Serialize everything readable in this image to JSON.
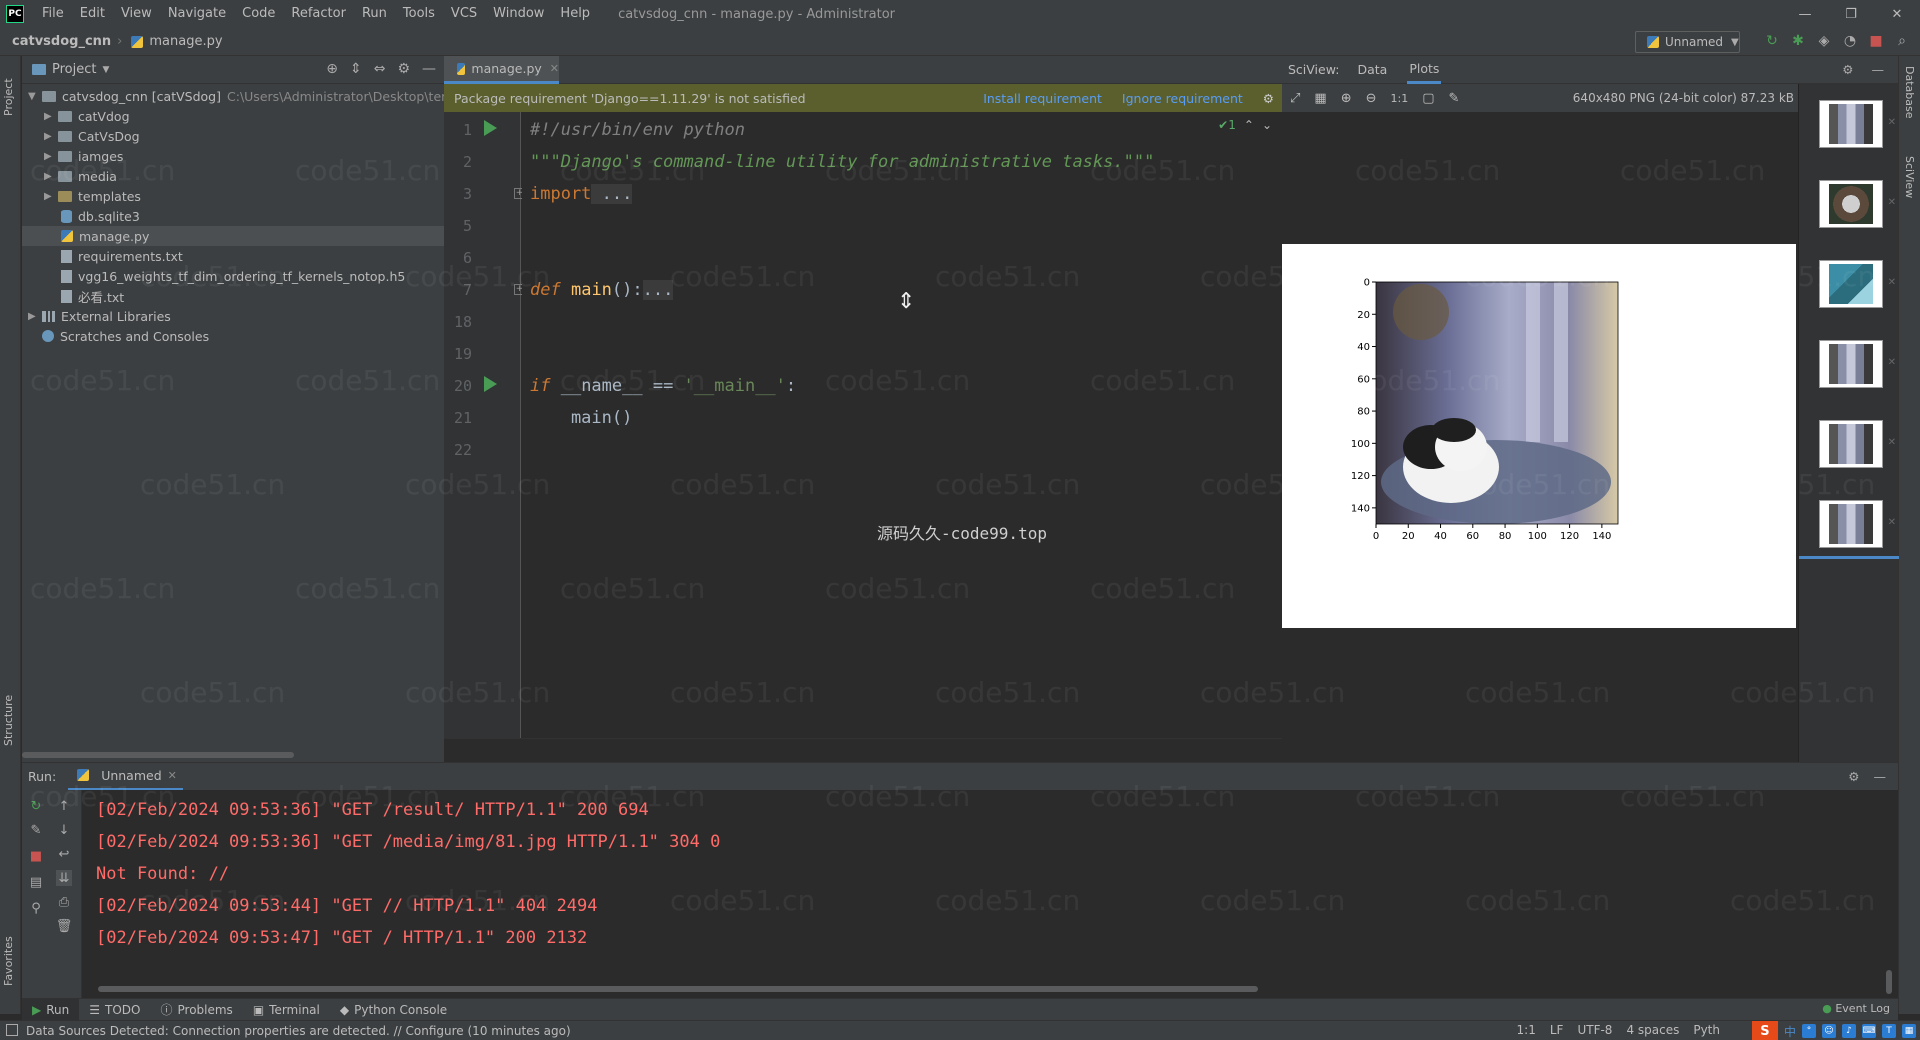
{
  "window": {
    "title": "catvsdog_cnn - manage.py - Administrator",
    "app_logo": "PC",
    "controls": [
      "—",
      "❐",
      "✕"
    ]
  },
  "menu": [
    "File",
    "Edit",
    "View",
    "Navigate",
    "Code",
    "Refactor",
    "Run",
    "Tools",
    "VCS",
    "Window",
    "Help"
  ],
  "navbar": {
    "project": "catvsdog_cnn",
    "file": "manage.py",
    "run_config": "Unnamed"
  },
  "left_strip": {
    "project_tab": "Project",
    "structure_tab": "Structure",
    "favorites_tab": "Favorites"
  },
  "right_strip": {
    "database_tab": "Database",
    "sciview_tab": "SciView"
  },
  "project_pane": {
    "header": "Project",
    "root": {
      "name": "catvsdog_cnn [catVSdog]",
      "path": "C:\\Users\\Administrator\\Desktop\\temp"
    },
    "items": [
      {
        "label": "catVdog",
        "kind": "folder"
      },
      {
        "label": "CatVsDog",
        "kind": "folder"
      },
      {
        "label": "iamges",
        "kind": "folder"
      },
      {
        "label": "media",
        "kind": "folder"
      },
      {
        "label": "templates",
        "kind": "folder"
      },
      {
        "label": "db.sqlite3",
        "kind": "db"
      },
      {
        "label": "manage.py",
        "kind": "py"
      },
      {
        "label": "requirements.txt",
        "kind": "file"
      },
      {
        "label": "vgg16_weights_tf_dim_ordering_tf_kernels_notop.h5",
        "kind": "file"
      },
      {
        "label": "必看.txt",
        "kind": "file"
      }
    ],
    "external_libraries": "External Libraries",
    "scratches": "Scratches and Consoles"
  },
  "editor": {
    "tab": "manage.py",
    "banner": {
      "message": "Package requirement 'Django==1.11.29' is not satisfied",
      "install": "Install requirement",
      "ignore": "Ignore requirement"
    },
    "inspection_count": "✔1",
    "line_numbers": [
      "1",
      "2",
      "3",
      "5",
      "6",
      "7",
      "18",
      "19",
      "20",
      "21",
      "22"
    ],
    "code": {
      "l1": "#!/usr/bin/env python",
      "l2": "\"\"\"Django's command-line utility for administrative tasks.\"\"\"",
      "l3_kw": "import",
      "l3_fold": " ...",
      "l7_def": "def",
      "l7_name": "main",
      "l7_paren": "():",
      "l7_fold": "...",
      "l20_if": "if",
      "l20_rest": " __name__ == ",
      "l20_str": "'__main__'",
      "l20_colon": ":",
      "l21": "    main()"
    },
    "overlay_text": "源码久久-code99.top"
  },
  "sciview": {
    "label": "SciView:",
    "tabs": [
      "Data",
      "Plots"
    ],
    "active_tab": "Plots",
    "image_info": "640x480 PNG (24-bit color) 87.23 kB",
    "toolbar_icons": [
      "fit-icon",
      "grid-icon",
      "zoom-in-icon",
      "zoom-out-icon",
      "actual-size-icon",
      "background-icon",
      "eyedropper-icon"
    ],
    "toolbar_actual_size": "1:1",
    "thumbnails": [
      "cat",
      "dog",
      "teal",
      "cat",
      "cat",
      "cat"
    ]
  },
  "chart_data": {
    "type": "image",
    "title": "",
    "xlabel": "",
    "ylabel": "",
    "x_ticks": [
      "0",
      "20",
      "40",
      "60",
      "80",
      "100",
      "120",
      "140"
    ],
    "y_ticks": [
      "0",
      "20",
      "40",
      "60",
      "80",
      "100",
      "120",
      "140"
    ],
    "xlim": [
      0,
      150
    ],
    "ylim": [
      150,
      0
    ],
    "content": "cat photo"
  },
  "run_panel": {
    "label": "Run:",
    "tab": "Unnamed",
    "lines": [
      "[02/Feb/2024 09:53:36] \"GET /result/ HTTP/1.1\" 200 694",
      "[02/Feb/2024 09:53:36] \"GET /media/img/81.jpg HTTP/1.1\" 304 0",
      "Not Found: //",
      "[02/Feb/2024 09:53:44] \"GET // HTTP/1.1\" 404 2494",
      "[02/Feb/2024 09:53:47] \"GET / HTTP/1.1\" 200 2132"
    ]
  },
  "bottom_tabs": [
    "Run",
    "TODO",
    "Problems",
    "Terminal",
    "Python Console"
  ],
  "event_log": "Event Log",
  "status": {
    "message": "Data Sources Detected: Connection properties are detected. // Configure (10 minutes ago)",
    "position": "1:1",
    "line_sep": "LF",
    "encoding": "UTF-8",
    "indent": "4 spaces",
    "interpreter": "Pyth",
    "ime": "S",
    "ime_lang": "中"
  },
  "watermark": "code51.cn",
  "colors": {
    "accent": "#4a88c7",
    "error_text": "#ff6b68",
    "banner": "#5b5f2d",
    "run_green": "#499c54"
  }
}
